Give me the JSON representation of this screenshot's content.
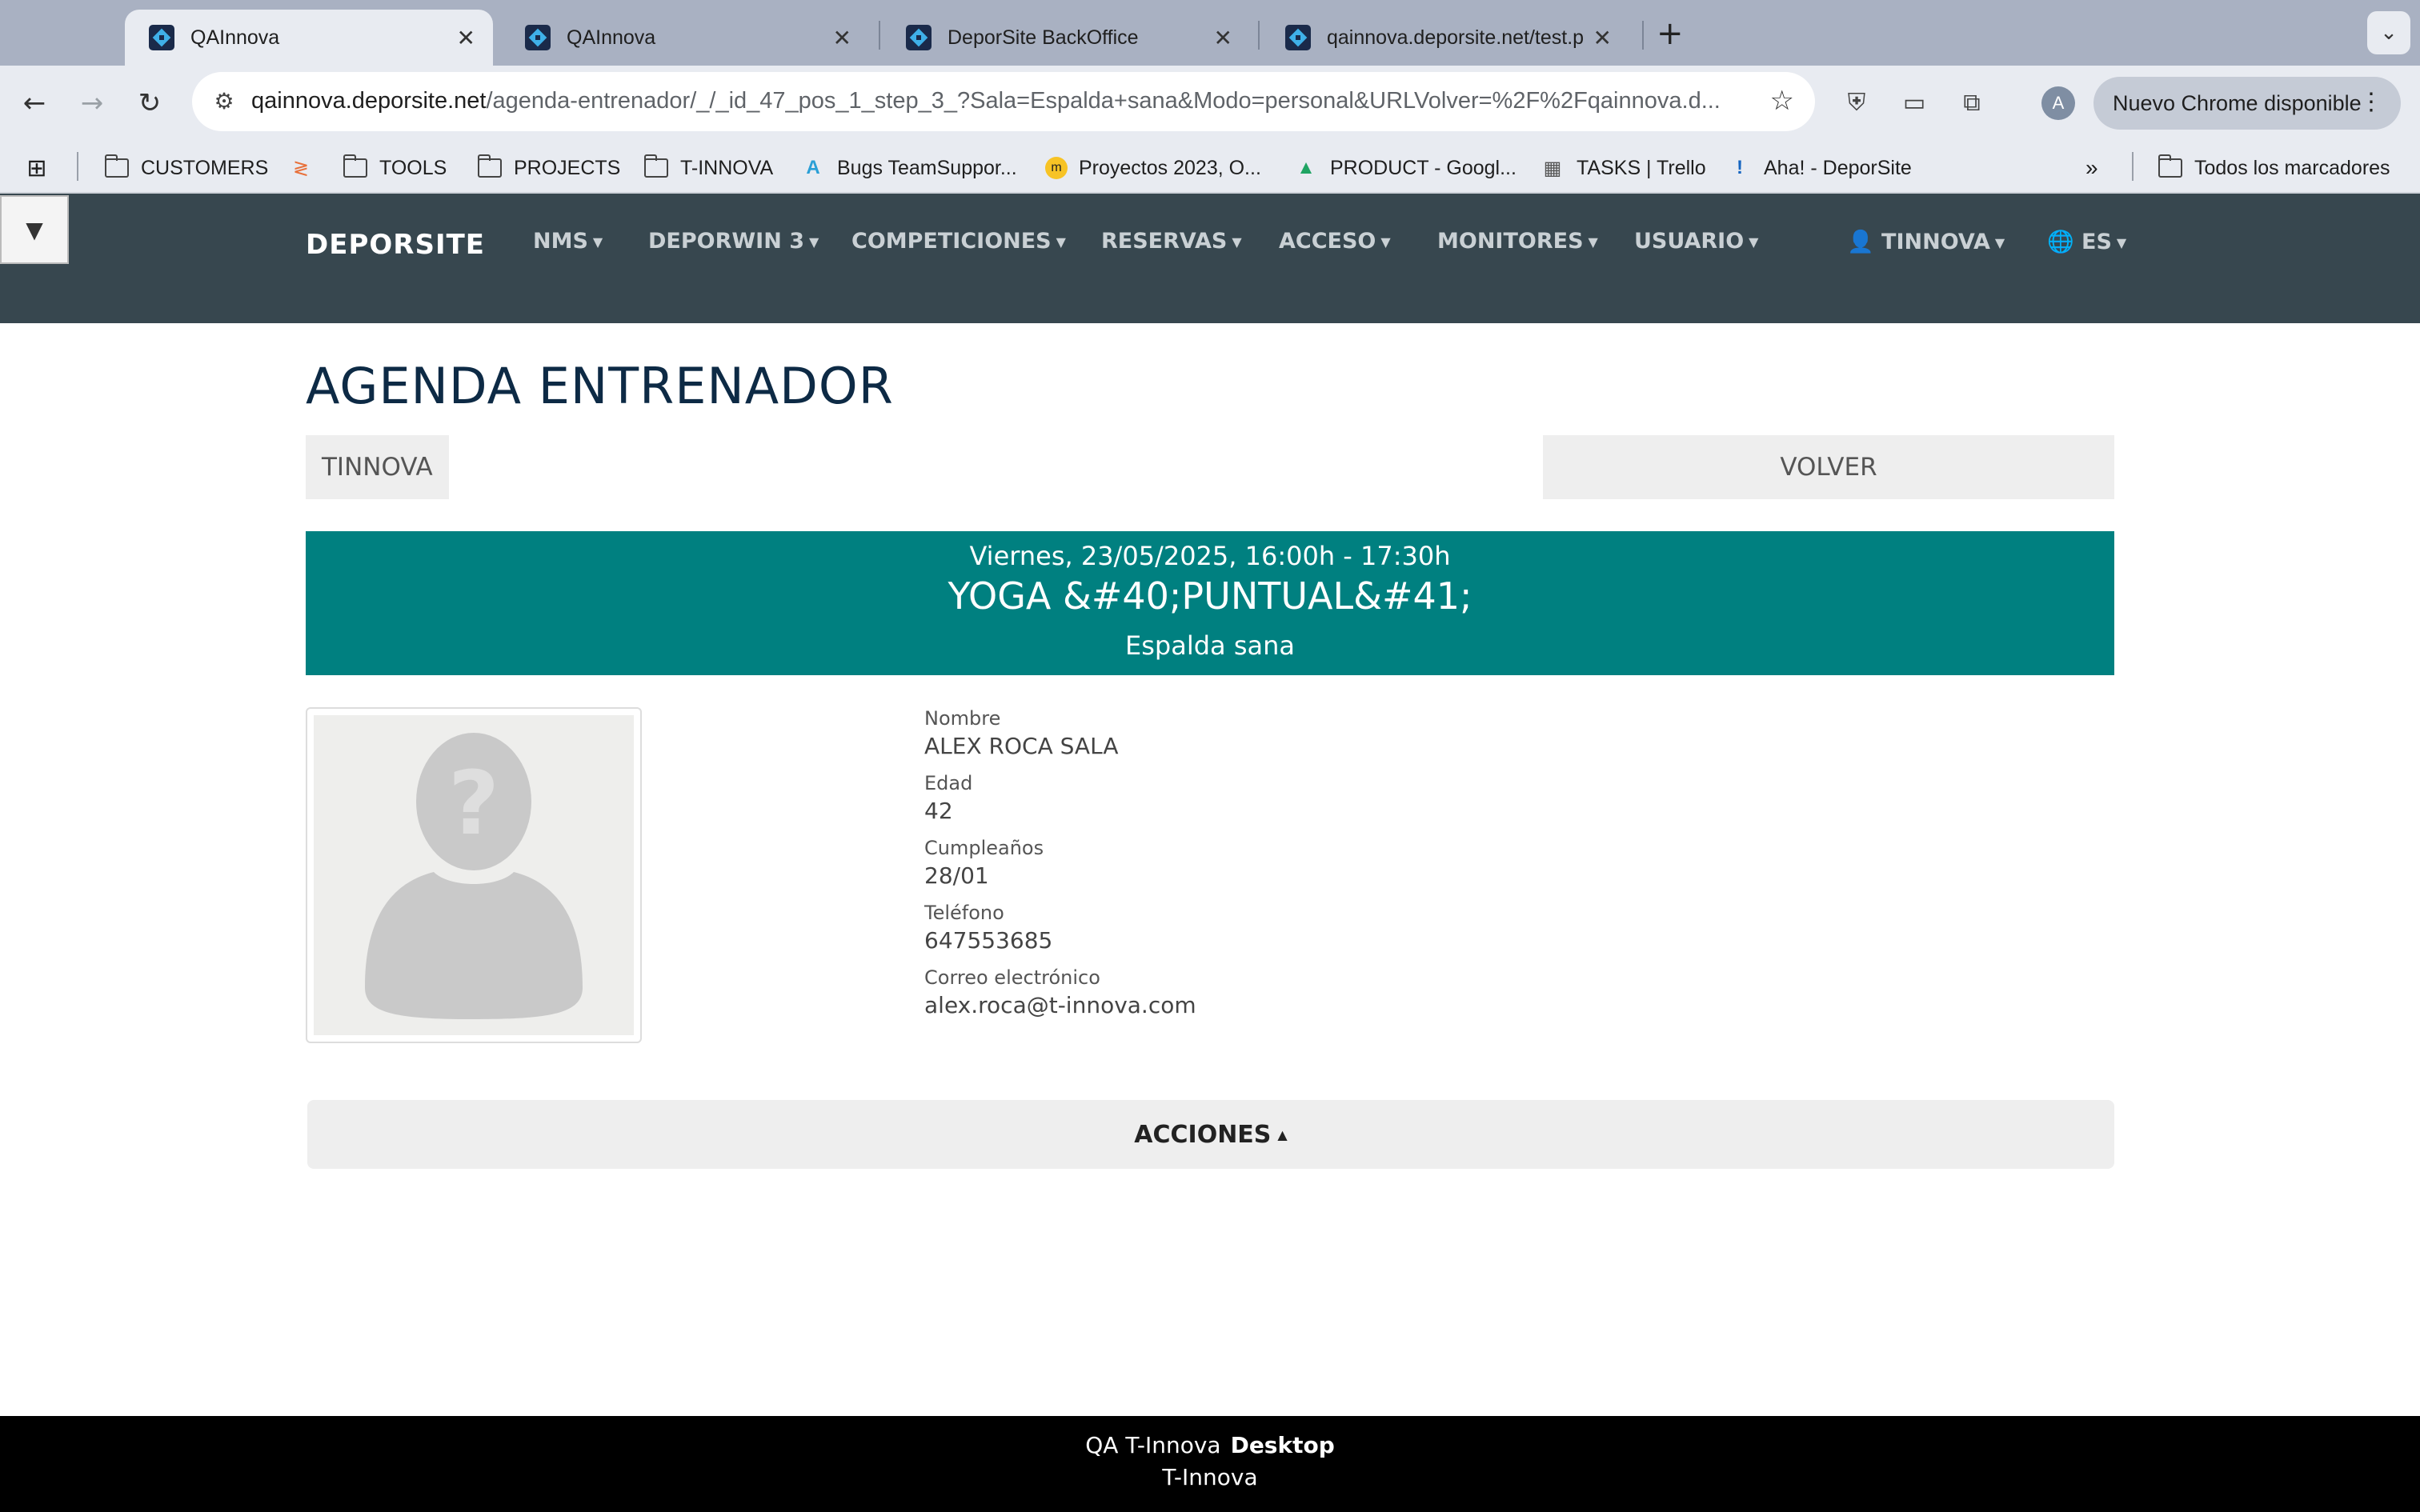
{
  "browser": {
    "tabs": [
      {
        "title": "QAInnova",
        "active": true
      },
      {
        "title": "QAInnova",
        "active": false
      },
      {
        "title": "DeporSite BackOffice",
        "active": false
      },
      {
        "title": "qainnova.deporsite.net/test.p",
        "active": false
      }
    ],
    "new_tab_icon": "plus-icon",
    "url_host": "qainnova.deporsite.net",
    "url_path": "/agenda-entrenador/_/_id_47_pos_1_step_3_?Sala=Espalda+sana&Modo=personal&URLVolver=%2F%2Fqainnova.d...",
    "update_button": "Nuevo Chrome disponible",
    "profile_initial": "A",
    "bookmarks": [
      {
        "label": "CUSTOMERS",
        "icon": "folder-icon"
      },
      {
        "label": "",
        "icon": "app-icon"
      },
      {
        "label": "TOOLS",
        "icon": "folder-icon"
      },
      {
        "label": "PROJECTS",
        "icon": "folder-icon"
      },
      {
        "label": "T-INNOVA",
        "icon": "folder-icon"
      },
      {
        "label": "Bugs TeamSuppor...",
        "icon": "teamsupport-icon"
      },
      {
        "label": "Proyectos 2023, O...",
        "icon": "monday-icon"
      },
      {
        "label": "PRODUCT - Googl...",
        "icon": "drive-icon"
      },
      {
        "label": "TASKS | Trello",
        "icon": "trello-icon"
      },
      {
        "label": "Aha! - DeporSite",
        "icon": "aha-icon"
      }
    ],
    "all_bookmarks": "Todos los marcadores"
  },
  "nav": {
    "brand": "DEPORSITE",
    "items": [
      "NMS",
      "DEPORWIN 3",
      "COMPETICIONES",
      "RESERVAS",
      "ACCESO",
      "MONITORES",
      "USUARIO"
    ],
    "user": "TINNOVA",
    "lang": "ES"
  },
  "page": {
    "title": "AGENDA ENTRENADOR",
    "tag": "TINNOVA",
    "back": "VOLVER"
  },
  "session": {
    "datetime": "Viernes, 23/05/2025, 16:00h - 17:30h",
    "activity": "YOGA &#40;PUNTUAL&#41;",
    "room": "Espalda sana"
  },
  "person": {
    "fields": [
      {
        "label": "Nombre",
        "value": "ALEX ROCA SALA"
      },
      {
        "label": "Edad",
        "value": "42"
      },
      {
        "label": "Cumpleaños",
        "value": "28/01"
      },
      {
        "label": "Teléfono",
        "value": "647553685"
      },
      {
        "label": "Correo electrónico",
        "value": "alex.roca@t-innova.com"
      }
    ]
  },
  "actions": {
    "label": "ACCIONES"
  },
  "footer": {
    "line1_prefix": "QA T-Innova",
    "line1_bold": "Desktop",
    "line2": "T-Innova"
  },
  "colors": {
    "nav_bg": "#37474f",
    "banner_bg": "#008080",
    "title": "#0d2a45",
    "footer_bg": "#000000"
  }
}
